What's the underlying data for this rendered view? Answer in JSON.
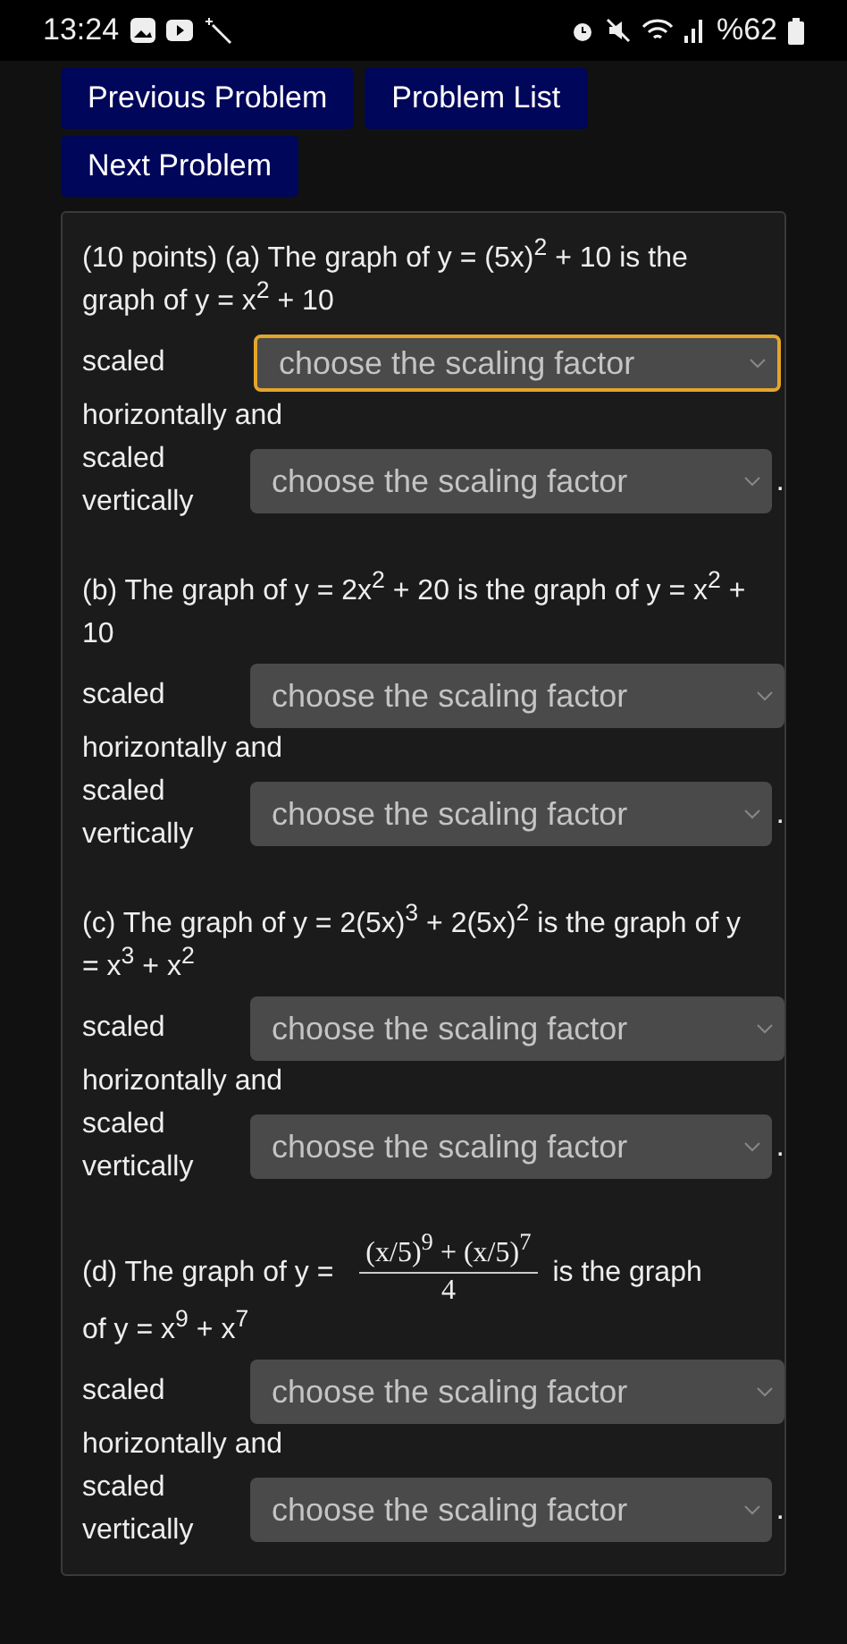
{
  "status_bar": {
    "time": "13:24",
    "battery": "%62"
  },
  "nav_buttons": [
    "Previous Problem",
    "Problem List",
    "Next Problem"
  ],
  "questions": [
    {
      "parts": [
        {
          "kind": "text",
          "text": "(10 points) (a) The graph of y = (5x)$^{2}$ + 10 is the graph of y = x$^{2}$ + 10"
        }
      ],
      "rows": [
        {
          "label": "scaled",
          "select": {
            "placeholder": "choose the scaling factor",
            "focused": true
          }
        },
        {
          "label": "horizontally and"
        },
        {
          "label": "scaled vertically",
          "select": {
            "placeholder": "choose the scaling factor",
            "focused": false
          },
          "end": "."
        }
      ]
    },
    {
      "parts": [
        {
          "kind": "text",
          "text": "(b) The graph of y = 2x$^{2}$ + 20 is the graph of y = x$^{2}$ + 10"
        }
      ],
      "rows": [
        {
          "label": "scaled",
          "select": {
            "placeholder": "choose the scaling factor",
            "focused": false
          }
        },
        {
          "label": "horizontally and"
        },
        {
          "label": "scaled vertically",
          "select": {
            "placeholder": "choose the scaling factor",
            "focused": false
          },
          "end": "."
        }
      ]
    },
    {
      "parts": [
        {
          "kind": "text",
          "text": "(c) The graph of y = 2(5x)$^{3}$ + 2(5x)$^{2}$ is the graph of y = x$^{3}$ + x$^{2}$"
        }
      ],
      "rows": [
        {
          "label": "scaled",
          "select": {
            "placeholder": "choose the scaling factor",
            "focused": false
          }
        },
        {
          "label": "horizontally and"
        },
        {
          "label": "scaled vertically",
          "select": {
            "placeholder": "choose the scaling factor",
            "focused": false
          },
          "end": "."
        }
      ]
    },
    {
      "parts": [
        {
          "kind": "text",
          "text": "(d) The graph of y ="
        },
        {
          "kind": "fraction",
          "numerator": "(x/5)$^{9}$ + (x/5)$^{7}$",
          "denominator": "4"
        },
        {
          "kind": "text",
          "text": "is the graph"
        },
        {
          "kind": "text",
          "text": "of y = x$^{9}$ + x$^{7}$"
        }
      ],
      "rows": [
        {
          "label": "scaled",
          "select": {
            "placeholder": "choose the scaling factor",
            "focused": false
          }
        },
        {
          "label": "horizontally and"
        },
        {
          "label": "scaled vertically",
          "select": {
            "placeholder": "choose the scaling factor",
            "focused": false
          },
          "end": "."
        }
      ]
    }
  ]
}
